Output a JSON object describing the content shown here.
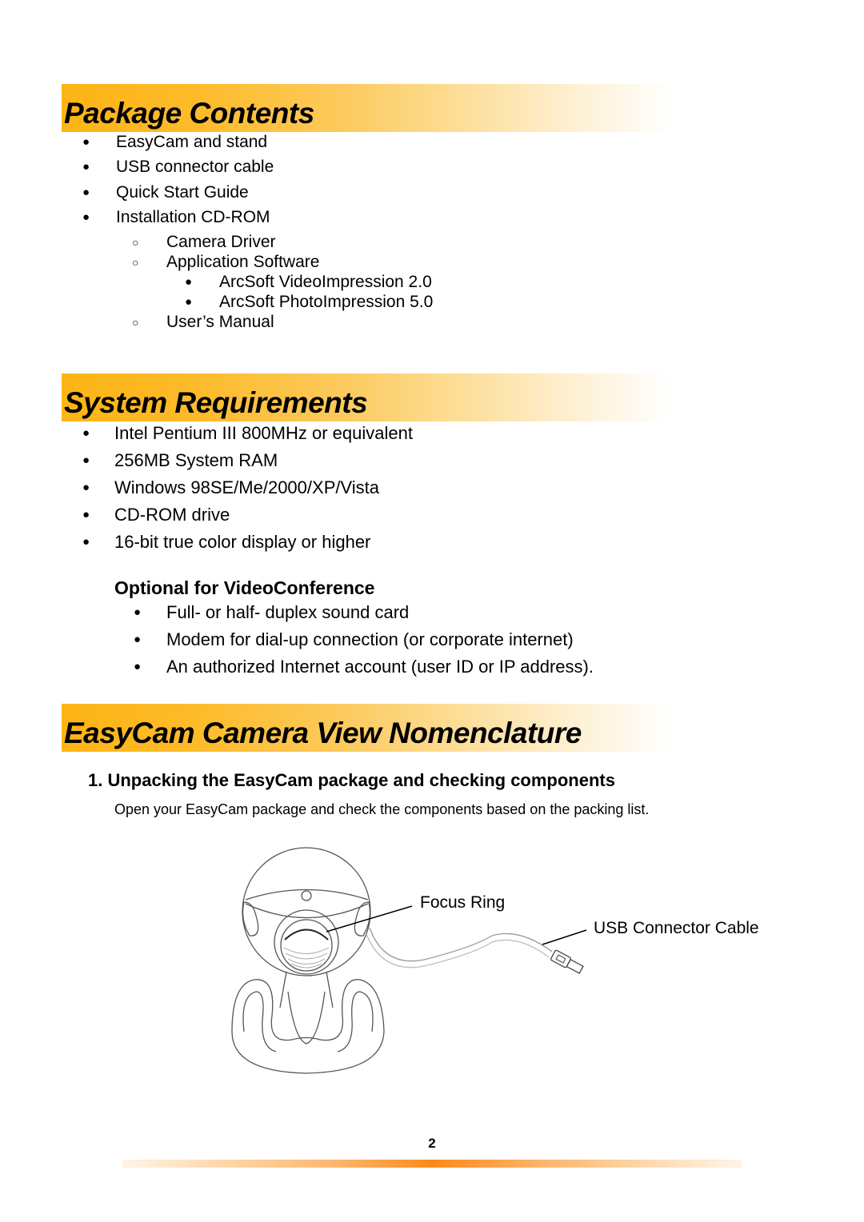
{
  "sections": {
    "package_contents": {
      "title": "Package Contents",
      "items": [
        "EasyCam and stand",
        "USB connector cable",
        "Quick Start Guide",
        "Installation CD-ROM"
      ],
      "cd_rom_items": [
        "Camera Driver",
        "Application Software"
      ],
      "software_items": [
        "ArcSoft VideoImpression 2.0",
        "ArcSoft PhotoImpression 5.0"
      ],
      "manual_item": "User’s Manual"
    },
    "system_requirements": {
      "title": "System Requirements",
      "items": [
        "Intel Pentium III 800MHz or equivalent",
        "256MB System RAM",
        "Windows 98SE/Me/2000/XP/Vista",
        "CD-ROM drive",
        "16-bit true color display or higher"
      ],
      "optional_heading": "Optional for VideoConference",
      "optional_items": [
        "Full- or half- duplex sound card",
        "Modem for dial-up connection (or corporate internet)",
        "An authorized Internet account (user ID or IP address)."
      ]
    },
    "nomenclature": {
      "title": "EasyCam Camera View Nomenclature",
      "step_heading": "1. Unpacking the EasyCam package and checking components",
      "step_text": "Open your EasyCam package and check the components based on the packing list.",
      "labels": {
        "focus_ring": "Focus Ring",
        "usb_cable": "USB Connector Cable"
      }
    }
  },
  "bullets": {
    "filled": "●",
    "hollow": "○"
  },
  "page_number": "2",
  "colors": {
    "banner_accent": "#fdb415",
    "footer_accent": "#fd8a1c"
  }
}
